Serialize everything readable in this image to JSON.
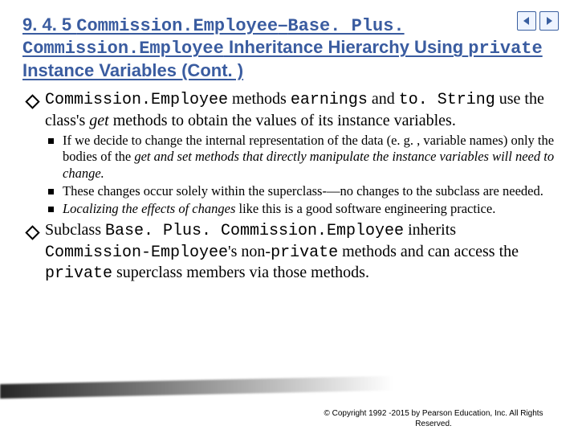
{
  "nav": {
    "prev": "◀",
    "next": "▶"
  },
  "title": {
    "sec": "9. 4. 5 ",
    "p1": "Commission.Employee",
    "dash": "–",
    "p2": "Base. Plus. Commission.Employee",
    "rest": " Inheritance Hierarchy Using ",
    "kw": "private",
    "cont": " Instance Variables (Cont. )"
  },
  "b1": {
    "c1": "Commission.Employee",
    "t1": " methods ",
    "c2": "earnings",
    "t2": " and ",
    "c3": "to. String",
    "t3": " use the class's ",
    "i1": "get",
    "t4": " methods to obtain the values of its instance variables."
  },
  "s1": {
    "t1": "If we decide to change the internal representation of the data (e. g. , variable names) only the bodies of the ",
    "i1": "get and set methods that directly manipulate the instance variables will need to change.",
    "t2": ""
  },
  "s2": "These changes occur solely within the superclass-—no changes to the subclass are needed.",
  "s3": {
    "i1": "Localizing the effects of changes",
    "t1": " like this is a good software engineering practice."
  },
  "b2": {
    "t1": "Subclass ",
    "c1": "Base. Plus. Commission.Employee",
    "t2": " inherits ",
    "c2": "Commission-Employee",
    "t3": "'s non-",
    "c3": "private",
    "t4": " methods and can access the ",
    "c4": "private",
    "t5": " superclass members via those methods."
  },
  "copyright": "© Copyright 1992 -2015 by Pearson Education, Inc. All Rights Reserved."
}
